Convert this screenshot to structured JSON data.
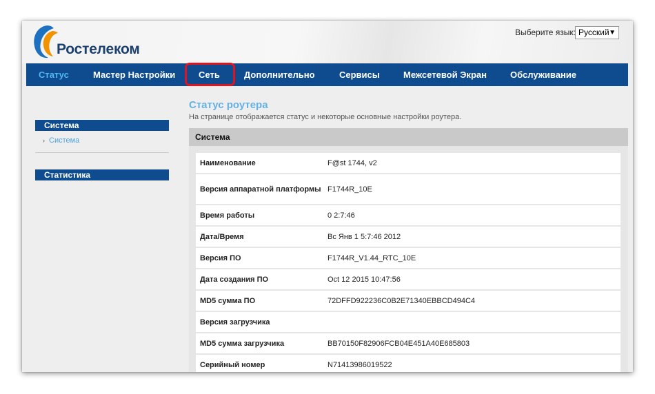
{
  "brand": {
    "name": "Ростелеком"
  },
  "language": {
    "label": "Выберите язык:",
    "selected": "Русский",
    "arrow": "▼"
  },
  "nav": {
    "items": [
      {
        "label": "Статус",
        "active": true
      },
      {
        "label": "Мастер Настройки"
      },
      {
        "label": "Сеть",
        "highlighted": true
      },
      {
        "label": "Дополнительно"
      },
      {
        "label": "Сервисы"
      },
      {
        "label": "Межсетевой Экран"
      },
      {
        "label": "Обслуживание"
      }
    ]
  },
  "sidebar": {
    "sections": [
      {
        "title": "Система",
        "items": [
          {
            "label": "Система",
            "bullet": "›"
          }
        ]
      },
      {
        "title": "Статистика",
        "items": []
      }
    ]
  },
  "main": {
    "title": "Статус роутера",
    "description": "На странице отображается статус и некоторые основные настройки роутера.",
    "section_title": "Система",
    "rows": [
      {
        "label": "Наименование",
        "value": "F@st 1744, v2"
      },
      {
        "label": "Версия аппаратной платформы",
        "value": "F1744R_10E"
      },
      {
        "label": "Время работы",
        "value": "0 2:7:46"
      },
      {
        "label": "Дата/Время",
        "value": "Вс Янв 1 5:7:46 2012"
      },
      {
        "label": "Версия ПО",
        "value": "F1744R_V1.44_RTC_10E"
      },
      {
        "label": "Дата создания ПО",
        "value": "Oct 12 2015 10:47:56"
      },
      {
        "label": "MD5 сумма ПО",
        "value": "72DFFD922236C0B2E71340EBBCD494C4"
      },
      {
        "label": "Версия загрузчика",
        "value": ""
      },
      {
        "label": "MD5 сумма загрузчика",
        "value": "BB70150F82906FCB04E451A40E685803"
      },
      {
        "label": "Серийный номер",
        "value": "N71413986019522"
      }
    ]
  },
  "colors": {
    "nav_bg": "#0f4c8f",
    "active": "#4db8f2",
    "title": "#65b1e4",
    "highlight": "#e0141e"
  }
}
